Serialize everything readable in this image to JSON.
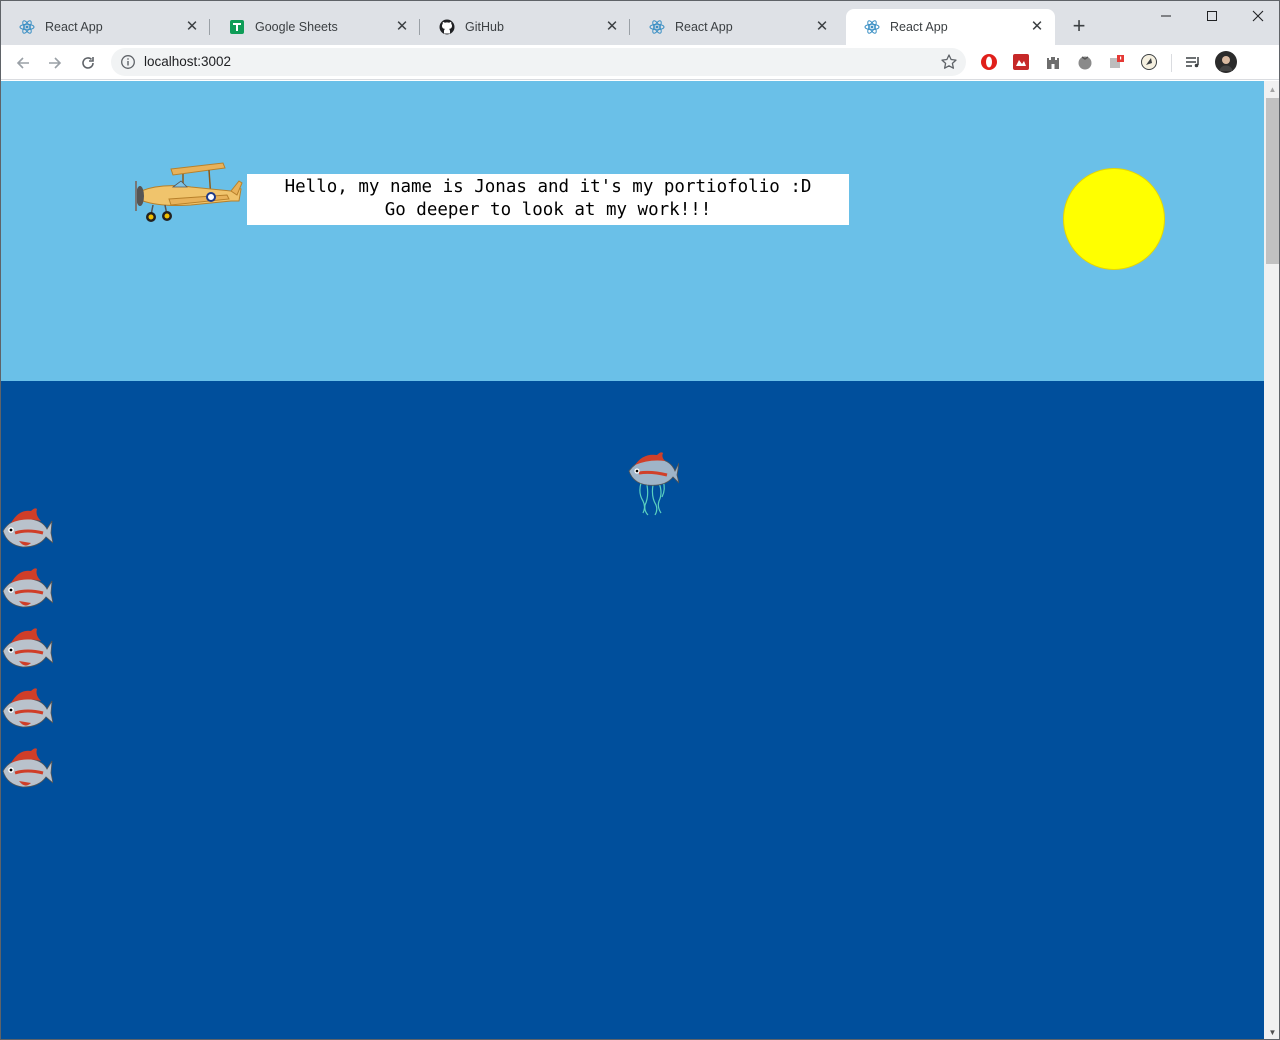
{
  "browser": {
    "tabs": [
      {
        "title": "React App",
        "icon": "react-icon",
        "active": false
      },
      {
        "title": "Google Sheets",
        "icon": "google-sheets-icon",
        "active": false
      },
      {
        "title": "GitHub",
        "icon": "github-icon",
        "active": false
      },
      {
        "title": "React App",
        "icon": "react-icon",
        "active": false
      },
      {
        "title": "React App",
        "icon": "react-icon",
        "active": true
      }
    ],
    "new_tab_label": "+",
    "close_glyph": "✕",
    "address": "localhost:3002"
  },
  "page": {
    "greeting_line1": "Hello, my name is Jonas and it's my portiofolio :D",
    "greeting_line2": "Go deeper to look at my work!!!"
  },
  "colors": {
    "sky": "#6ac0e8",
    "sea": "#004f9c",
    "sun": "#ffff00",
    "greeting_box": "#ffffff"
  }
}
